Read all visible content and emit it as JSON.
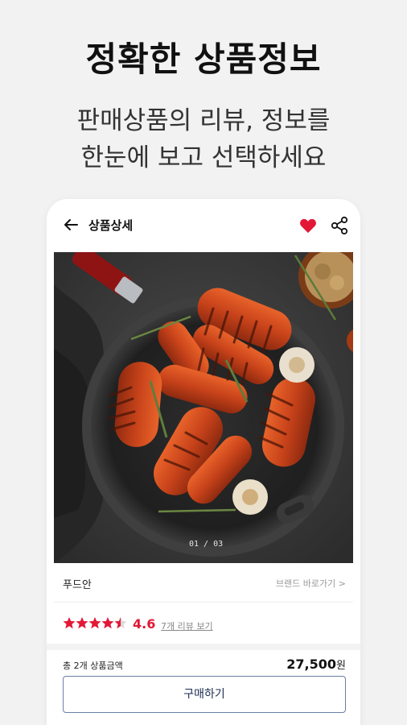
{
  "promo": {
    "headline": "정확한 상품정보",
    "subline1": "판매상품의 리뷰, 정보를",
    "subline2": "한눈에 보고 선택하세요"
  },
  "app": {
    "header": {
      "title": "상품상세",
      "favorited": true
    },
    "image": {
      "pager": "01 / 03"
    },
    "brand": {
      "name": "푸드안",
      "link": "브랜드 바로가기 >"
    },
    "rating": {
      "value": "4.6",
      "stars": 4.5,
      "max_stars": 5,
      "reviews_link": "7개 리뷰 보기"
    },
    "total": {
      "label": "총 2개 상품금액",
      "price": "27,500",
      "unit": "원"
    },
    "buy_button": "구매하기"
  },
  "colors": {
    "accent": "#e31837",
    "button_border": "#6b7fa6",
    "background": "#f2f2f2"
  }
}
